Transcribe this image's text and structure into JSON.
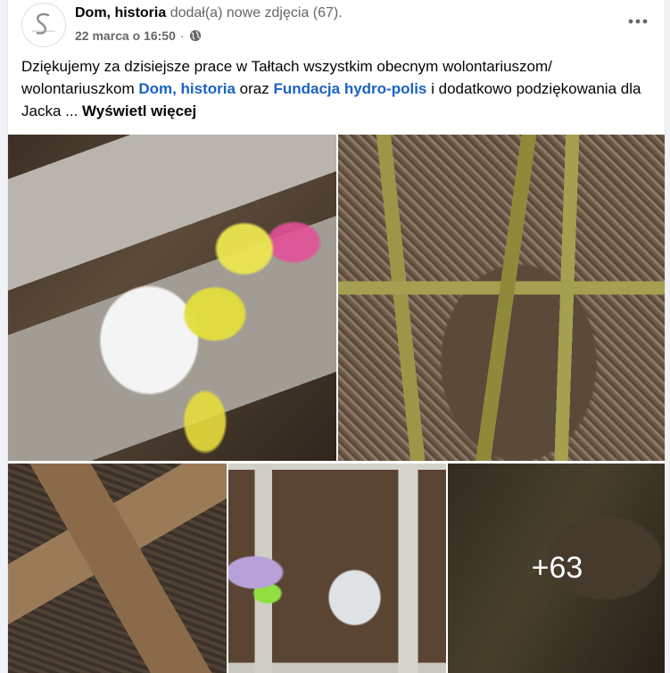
{
  "post": {
    "author": "Dom, historia",
    "action": "dodał(a) nowe zdjęcia (67).",
    "timestamp": "22 marca o 16:50",
    "separator": "·",
    "privacy_icon": "globe-icon",
    "more_icon": "more-horizontal-icon",
    "text_part1": "Dziękujemy za dzisiejsze prace w Tałtach wszystkim obecnym wolontariuszom/ wolontariuszkom ",
    "link1": "Dom, historia",
    "text_part2": " oraz ",
    "link2": "Fundacja hydro-polis",
    "text_part3": " i dodatkowo podziękowania dla  Jacka ... ",
    "see_more": "Wyświetl więcej"
  },
  "photos": {
    "extra_count": "+63"
  },
  "colors": {
    "link": "#1a63c4",
    "secondary_text": "#65676b",
    "background": "#f0f2f5"
  }
}
